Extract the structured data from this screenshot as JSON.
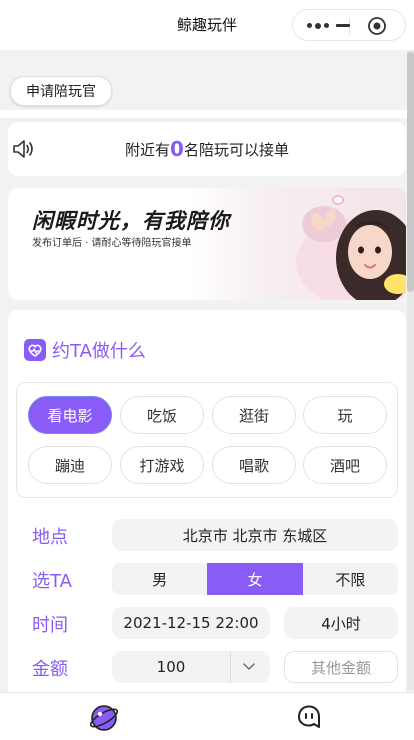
{
  "app": {
    "title": "鲸趣玩伴"
  },
  "header": {
    "apply_button": "申请陪玩官"
  },
  "notice": {
    "prefix": "附近有",
    "count": "0",
    "suffix": "名陪玩可以接单"
  },
  "banner": {
    "title": "闲暇时光，有我陪你",
    "subtitle": "发布订单后 · 请耐心等待陪玩官接单"
  },
  "section": {
    "title": "约TA做什么"
  },
  "activities": [
    {
      "label": "看电影",
      "selected": true
    },
    {
      "label": "吃饭",
      "selected": false
    },
    {
      "label": "逛街",
      "selected": false
    },
    {
      "label": "玩",
      "selected": false
    },
    {
      "label": "蹦迪",
      "selected": false
    },
    {
      "label": "打游戏",
      "selected": false
    },
    {
      "label": "唱歌",
      "selected": false
    },
    {
      "label": "酒吧",
      "selected": false
    }
  ],
  "form": {
    "location_label": "地点",
    "location_value": "北京市 北京市 东城区",
    "gender_label": "选TA",
    "gender_options": [
      "男",
      "女",
      "不限"
    ],
    "gender_selected": "女",
    "time_label": "时间",
    "time_value": "2021-12-15 22:00",
    "duration_value": "4小时",
    "amount_label": "金额",
    "amount_value": "100",
    "other_amount": "其他金额"
  },
  "icons": {
    "capsule_more": "more-dots-icon",
    "capsule_minimize": "minimize-icon",
    "capsule_close": "close-circle-icon",
    "speaker": "speaker-icon",
    "section": "heart-badge-icon",
    "dropdown": "chevron-down-icon",
    "tab_home": "planet-icon",
    "tab_message": "chat-face-icon"
  },
  "colors": {
    "accent": "#8a5cf6",
    "selected_chip_border": "#6b8cf0"
  }
}
